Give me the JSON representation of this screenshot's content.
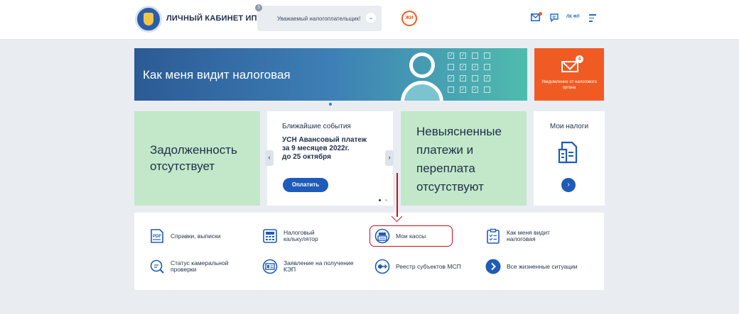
{
  "header": {
    "app_title": "ЛИЧНЫЙ КАБИНЕТ ИП",
    "user_select": {
      "value": "Уважаемый налогоплательщик!",
      "badge": "3"
    },
    "avatar_initials": "ЖИ",
    "lk_fl_label": "ЛК ФЛ"
  },
  "banner": {
    "title": "Как меня видит налоговая"
  },
  "notification_card": {
    "count": "4",
    "label": "Уведомление от налогового органа"
  },
  "cards": {
    "debt": {
      "text_line1": "Задолженность",
      "text_line2": "отсутствует"
    },
    "events": {
      "heading": "Ближайшие события",
      "line1": "УСН Авансовый платеж",
      "line2": "за 9 месяцев 2022г.",
      "line3": "до 25 октября",
      "pay_button": "Оплатить"
    },
    "unclear": {
      "line1": "Невыясненные",
      "line2": "платежи и",
      "line3": "переплата",
      "line4": "отсутствуют"
    },
    "taxes": {
      "heading": "Мои налоги"
    }
  },
  "services": [
    {
      "line1": "Справки, выписки",
      "line2": ""
    },
    {
      "line1": "Налоговый",
      "line2": "калькулятор"
    },
    {
      "line1": "Мои кассы",
      "line2": ""
    },
    {
      "line1": "Как меня видит",
      "line2": "налоговая"
    },
    {
      "line1": "Статус камеральной",
      "line2": "проверки"
    },
    {
      "line1": "Заявление на получение",
      "line2": "КЭП"
    },
    {
      "line1": "Реестр субъектов МСП",
      "line2": ""
    },
    {
      "line1": "Все жизненные ситуации",
      "line2": ""
    }
  ],
  "colors": {
    "accent_blue": "#1f5bb8",
    "notification_orange": "#f05b23",
    "card_green": "#c2e8c9",
    "annotation_red": "#c8101e"
  }
}
